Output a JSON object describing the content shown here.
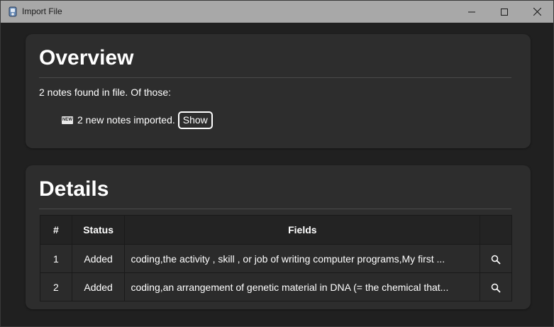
{
  "window": {
    "title": "Import File",
    "icon": "app-icon",
    "controls": [
      "minimize-icon",
      "maximize-icon",
      "close-icon"
    ]
  },
  "overview": {
    "heading": "Overview",
    "summary": "2 notes found in file. Of those:",
    "new_badge": "NEW",
    "new_text": "2 new notes imported.",
    "show_label": "Show"
  },
  "details": {
    "heading": "Details",
    "columns": [
      "#",
      "Status",
      "Fields",
      ""
    ],
    "rows": [
      {
        "num": "1",
        "status": "Added",
        "fields": "coding,the activity , skill , or job of writing computer programs,My first ...",
        "action_icon": "search-icon"
      },
      {
        "num": "2",
        "status": "Added",
        "fields": "coding,an arrangement of genetic material in DNA (= the chemical that...",
        "action_icon": "search-icon"
      }
    ]
  },
  "colors": {
    "background": "#202020",
    "card": "#2d2d2d",
    "titlebar": "#a8a8a8",
    "table_header": "#232323"
  }
}
